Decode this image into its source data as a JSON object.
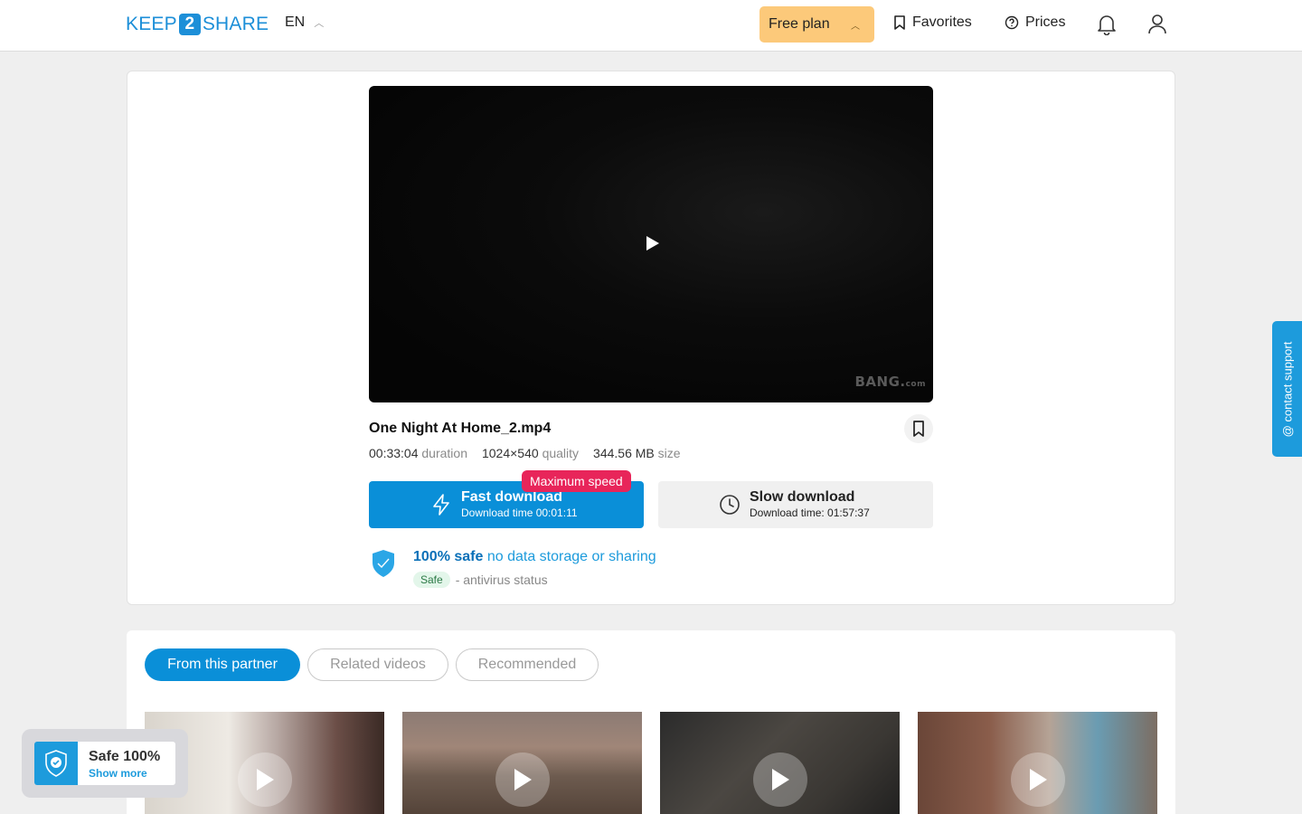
{
  "header": {
    "logo_left": "KEEP",
    "logo_num": "2",
    "logo_right": "SHARE",
    "lang": "EN",
    "plan_label": "Free plan",
    "favorites_label": "Favorites",
    "prices_label": "Prices"
  },
  "video": {
    "watermark": "BANG.",
    "watermark_suffix": "com"
  },
  "file": {
    "title": "One Night At Home_2.mp4",
    "duration_value": "00:33:04",
    "duration_label": "duration",
    "quality_value": "1024×540",
    "quality_label": "quality",
    "size_value": "344.56 MB",
    "size_label": "size"
  },
  "download": {
    "badge": "Maximum speed",
    "fast_title": "Fast download",
    "fast_sub": "Download time 00:01:11",
    "slow_title": "Slow download",
    "slow_sub": "Download time: 01:57:37"
  },
  "safety": {
    "bold": "100% safe",
    "text": "no data storage or sharing",
    "pill": "Safe",
    "status": "- antivirus status"
  },
  "support_label": "@ contact support",
  "tabs": [
    {
      "label": "From this partner"
    },
    {
      "label": "Related videos"
    },
    {
      "label": "Recommended"
    }
  ],
  "safe_widget": {
    "title": "Safe 100%",
    "link": "Show more"
  },
  "colors": {
    "accent": "#0a8fd8",
    "plan": "#fcc97a",
    "badge": "#e8255a"
  }
}
